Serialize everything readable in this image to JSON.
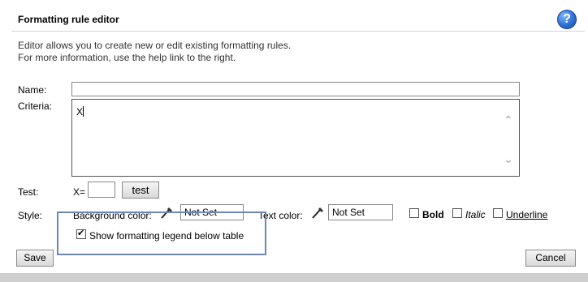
{
  "dialog": {
    "title": "Formatting rule editor",
    "help_icon": "question-mark-icon",
    "help_glyph": "?",
    "description_line1": "Editor allows you to create new or edit existing formatting rules.",
    "description_line2": "For more information, use the help link to the right."
  },
  "form": {
    "name_label": "Name:",
    "name_value": "",
    "criteria_label": "Criteria:",
    "criteria_value": "X",
    "test_label": "Test:",
    "test_prefix": "X=",
    "test_value": "",
    "test_button": "test",
    "style_label": "Style:",
    "background_color_label": "Background color:",
    "background_color_value": "Not Set",
    "text_color_label": "Text color:",
    "text_color_value": "Not Set",
    "bold_label": "Bold",
    "italic_label": "Italic",
    "underline_label": "Underline",
    "bold_checked": false,
    "italic_checked": false,
    "underline_checked": false,
    "legend_label": "Show formatting legend below table",
    "legend_checked": true
  },
  "actions": {
    "save_label": "Save",
    "cancel_label": "Cancel"
  },
  "colors": {
    "highlight_border": "#6a87b8",
    "help_icon": "#2f6fd6"
  }
}
